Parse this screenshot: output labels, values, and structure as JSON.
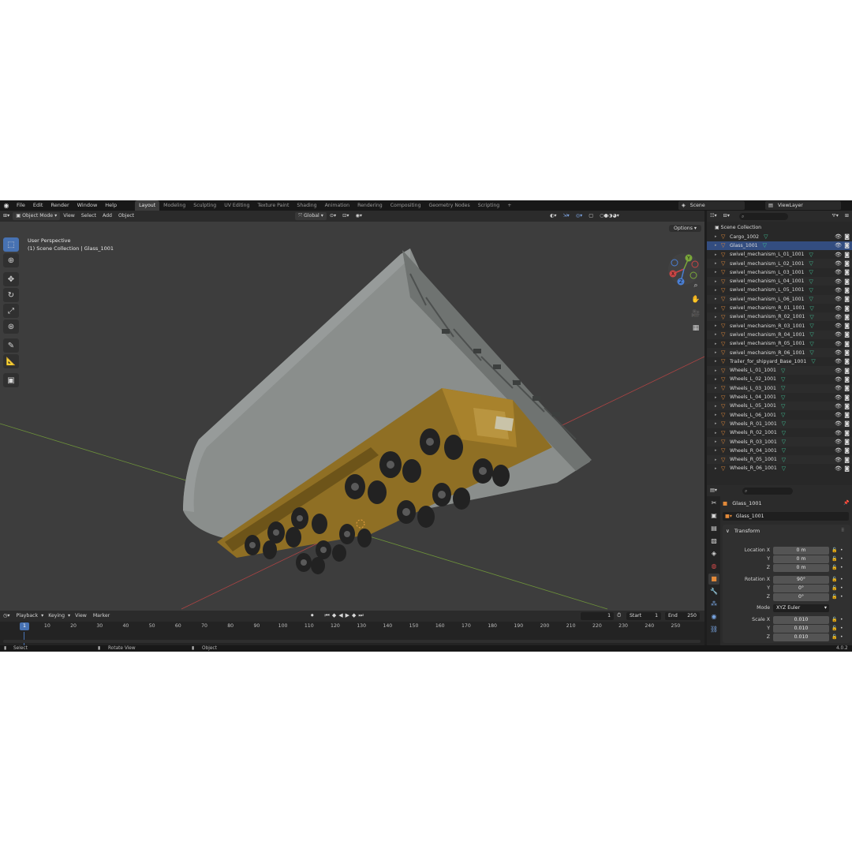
{
  "menus": [
    "File",
    "Edit",
    "Render",
    "Window",
    "Help"
  ],
  "workspaces": [
    "Layout",
    "Modeling",
    "Sculpting",
    "UV Editing",
    "Texture Paint",
    "Shading",
    "Animation",
    "Rendering",
    "Compositing",
    "Geometry Nodes",
    "Scripting"
  ],
  "active_workspace": "Layout",
  "scene_name": "Scene",
  "view_layer": "ViewLayer",
  "viewport": {
    "mode": "Object Mode",
    "menus": [
      "View",
      "Select",
      "Add",
      "Object"
    ],
    "transform_orientation": "Global",
    "options_label": "Options",
    "view_name": "User Perspective",
    "collection_info": "(1) Scene Collection | Glass_1001",
    "gizmo_axes": [
      "X",
      "Y",
      "Z"
    ]
  },
  "timeline": {
    "menus": [
      "Playback",
      "Keying",
      "View",
      "Marker"
    ],
    "current_frame": "1",
    "start_label": "Start",
    "start": "1",
    "end_label": "End",
    "end": "250",
    "ruler_marker": "1",
    "ticks": [
      "10",
      "20",
      "30",
      "40",
      "50",
      "60",
      "70",
      "80",
      "90",
      "100",
      "110",
      "120",
      "130",
      "140",
      "150",
      "160",
      "170",
      "180",
      "190",
      "200",
      "210",
      "220",
      "230",
      "240",
      "250"
    ]
  },
  "status_bar": {
    "select": "Select",
    "rotate": "Rotate View",
    "object": "Object",
    "version": "4.0.2"
  },
  "outliner": {
    "root": "Scene Collection",
    "items": [
      "Cargo_1002",
      "Glass_1001",
      "swivel_mechanism_L_01_1001",
      "swivel_mechanism_L_02_1001",
      "swivel_mechanism_L_03_1001",
      "swivel_mechanism_L_04_1001",
      "swivel_mechanism_L_05_1001",
      "swivel_mechanism_L_06_1001",
      "swivel_mechanism_R_01_1001",
      "swivel_mechanism_R_02_1001",
      "swivel_mechanism_R_03_1001",
      "swivel_mechanism_R_04_1001",
      "swivel_mechanism_R_05_1001",
      "swivel_mechanism_R_06_1001",
      "Trailer_for_shipyard_Base_1001",
      "Wheels_L_01_1001",
      "Wheels_L_02_1001",
      "Wheels_L_03_1001",
      "Wheels_L_04_1001",
      "Wheels_L_05_1001",
      "Wheels_L_06_1001",
      "Wheels_R_01_1001",
      "Wheels_R_02_1001",
      "Wheels_R_03_1001",
      "Wheels_R_04_1001",
      "Wheels_R_05_1001",
      "Wheels_R_06_1001"
    ],
    "selected": "Glass_1001"
  },
  "properties": {
    "object_name": "Glass_1001",
    "datablock_name": "Glass_1001",
    "panel_title": "Transform",
    "location_label": "Location X",
    "location": [
      "0 m",
      "0 m",
      "0 m"
    ],
    "rotation_label": "Rotation X",
    "rotation": [
      "90°",
      "0°",
      "0°"
    ],
    "mode_label": "Mode",
    "mode_value": "XYZ Euler",
    "scale_label": "Scale X",
    "scale": [
      "0.010",
      "0.010",
      "0.010"
    ],
    "axis_y": "Y",
    "axis_z": "Z"
  },
  "colors": {
    "accent": "#4772b3",
    "x_axis": "#c94545",
    "y_axis": "#7aa83a",
    "z_axis": "#4a7fd4",
    "object_icon": "#e38a3a",
    "mesh_icon": "#3fbf93"
  },
  "icons": [
    "blender-logo-icon",
    "cursor-icon",
    "move-icon",
    "rotate-icon",
    "scale-icon",
    "transform-icon",
    "annotate-icon",
    "measure-icon",
    "add-cube-icon",
    "zoom-icon",
    "hand-icon",
    "camera-icon",
    "grid-icon",
    "eye-icon",
    "camera-render-icon",
    "filter-icon",
    "play-icon"
  ]
}
